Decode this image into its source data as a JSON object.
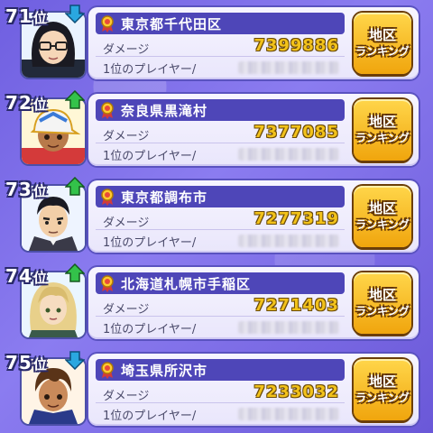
{
  "colors": {
    "trend_up": "#33c24a",
    "trend_down": "#2aa7e0",
    "damage": "#f2c21a",
    "location_bar": "#4e46b8",
    "button": "#f8c52a"
  },
  "entries": [
    {
      "rank": "71",
      "rank_suffix": "位",
      "trend": "down",
      "trend_icon": "down-arrow-icon",
      "medal_icon": "medal-icon",
      "location": "東京都千代田区",
      "damage_label": "ダメージ",
      "damage": "7399886",
      "player_label": "1位のプレイヤー/",
      "button_line1": "地区",
      "button_line2": "ランキング",
      "avatar": "girl-glasses-black-hair"
    },
    {
      "rank": "72",
      "rank_suffix": "位",
      "trend": "up",
      "trend_icon": "up-arrow-icon",
      "medal_icon": "medal-icon",
      "location": "奈良県黒滝村",
      "damage_label": "ダメージ",
      "damage": "7377085",
      "player_label": "1位のプレイヤー/",
      "button_line1": "地区",
      "button_line2": "ランキング",
      "avatar": "boy-cap-tan"
    },
    {
      "rank": "73",
      "rank_suffix": "位",
      "trend": "up",
      "trend_icon": "up-arrow-icon",
      "medal_icon": "medal-icon",
      "location": "東京都調布市",
      "damage_label": "ダメージ",
      "damage": "7277319",
      "player_label": "1位のプレイヤー/",
      "button_line1": "地区",
      "button_line2": "ランキング",
      "avatar": "man-suit"
    },
    {
      "rank": "74",
      "rank_suffix": "位",
      "trend": "up",
      "trend_icon": "up-arrow-icon",
      "medal_icon": "medal-icon",
      "location": "北海道札幌市手稲区",
      "damage_label": "ダメージ",
      "damage": "7271403",
      "player_label": "1位のプレイヤー/",
      "button_line1": "地区",
      "button_line2": "ランキング",
      "avatar": "blonde-girl"
    },
    {
      "rank": "75",
      "rank_suffix": "位",
      "trend": "down",
      "trend_icon": "down-arrow-icon",
      "medal_icon": "medal-icon",
      "location": "埼玉県所沢市",
      "damage_label": "ダメージ",
      "damage": "7233032",
      "player_label": "1位のプレイヤー/",
      "button_line1": "地区",
      "button_line2": "ランキング",
      "avatar": "boy-brown-hair"
    }
  ]
}
